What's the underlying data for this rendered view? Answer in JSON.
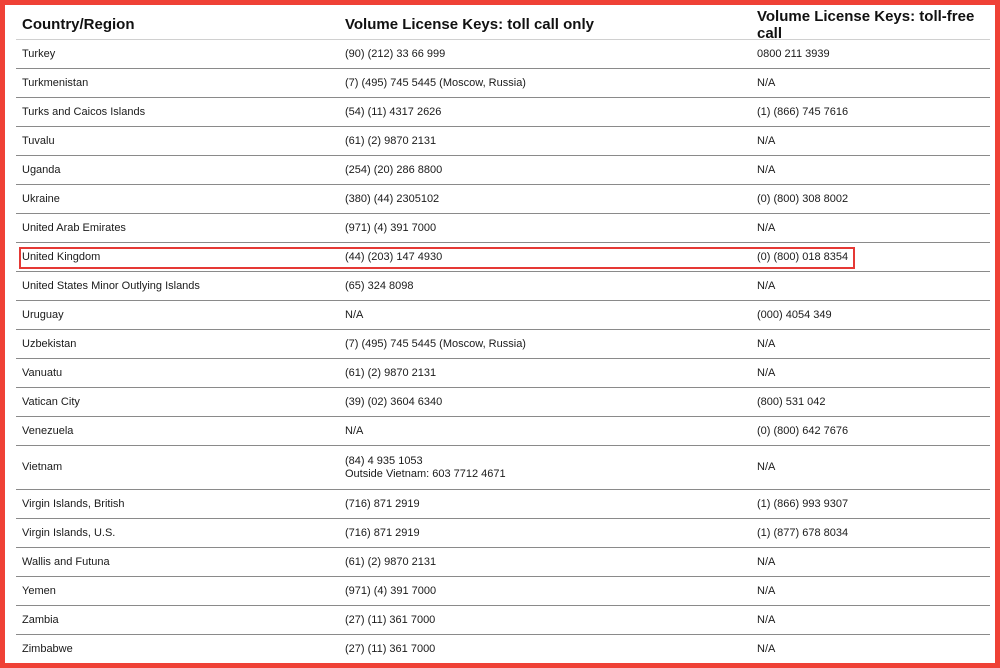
{
  "headers": {
    "country": "Country/Region",
    "toll": "Volume License Keys: toll call only",
    "free": "Volume License Keys: toll-free call"
  },
  "rows": [
    {
      "country": "Turkey",
      "toll": "(90) (212) 33 66 999",
      "free": "0800 211 3939"
    },
    {
      "country": "Turkmenistan",
      "toll": "(7) (495) 745 5445 (Moscow, Russia)",
      "free": "N/A"
    },
    {
      "country": "Turks and Caicos Islands",
      "toll": "(54) (11) 4317 2626",
      "free": "(1) (866) 745 7616"
    },
    {
      "country": "Tuvalu",
      "toll": "(61) (2) 9870 2131",
      "free": "N/A"
    },
    {
      "country": "Uganda",
      "toll": "(254) (20) 286 8800",
      "free": "N/A"
    },
    {
      "country": "Ukraine",
      "toll": "(380) (44) 2305102",
      "free": "(0) (800) 308 8002"
    },
    {
      "country": "United Arab Emirates",
      "toll": "(971) (4) 391 7000",
      "free": "N/A"
    },
    {
      "country": "United Kingdom",
      "toll": "(44) (203) 147 4930",
      "free": "(0) (800) 018 8354",
      "highlighted": true
    },
    {
      "country": "United States Minor Outlying Islands",
      "toll": "(65) 324 8098",
      "free": "N/A"
    },
    {
      "country": "Uruguay",
      "toll": "N/A",
      "free": "(000) 4054 349"
    },
    {
      "country": "Uzbekistan",
      "toll": "(7) (495) 745 5445 (Moscow, Russia)",
      "free": "N/A"
    },
    {
      "country": "Vanuatu",
      "toll": "(61) (2) 9870 2131",
      "free": "N/A"
    },
    {
      "country": "Vatican City",
      "toll": "(39) (02) 3604 6340",
      "free": "(800) 531 042"
    },
    {
      "country": "Venezuela",
      "toll": "N/A",
      "free": "(0) (800) 642 7676"
    },
    {
      "country": "Vietnam",
      "toll": "(84) 4 935 1053",
      "toll_line2": "Outside Vietnam: 603 7712 4671",
      "free": "N/A"
    },
    {
      "country": "Virgin Islands, British",
      "toll": "(716) 871 2919",
      "free": "(1) (866) 993 9307"
    },
    {
      "country": "Virgin Islands, U.S.",
      "toll": "(716) 871 2919",
      "free": "(1) (877) 678 8034"
    },
    {
      "country": "Wallis and Futuna",
      "toll": "(61) (2) 9870 2131",
      "free": "N/A"
    },
    {
      "country": "Yemen",
      "toll": "(971) (4) 391 7000",
      "free": "N/A"
    },
    {
      "country": "Zambia",
      "toll": "(27) (11) 361 7000",
      "free": "N/A"
    },
    {
      "country": "Zimbabwe",
      "toll": "(27) (11) 361 7000",
      "free": "N/A"
    }
  ],
  "colors": {
    "frame": "#ef4136",
    "highlight": "#e53935"
  }
}
